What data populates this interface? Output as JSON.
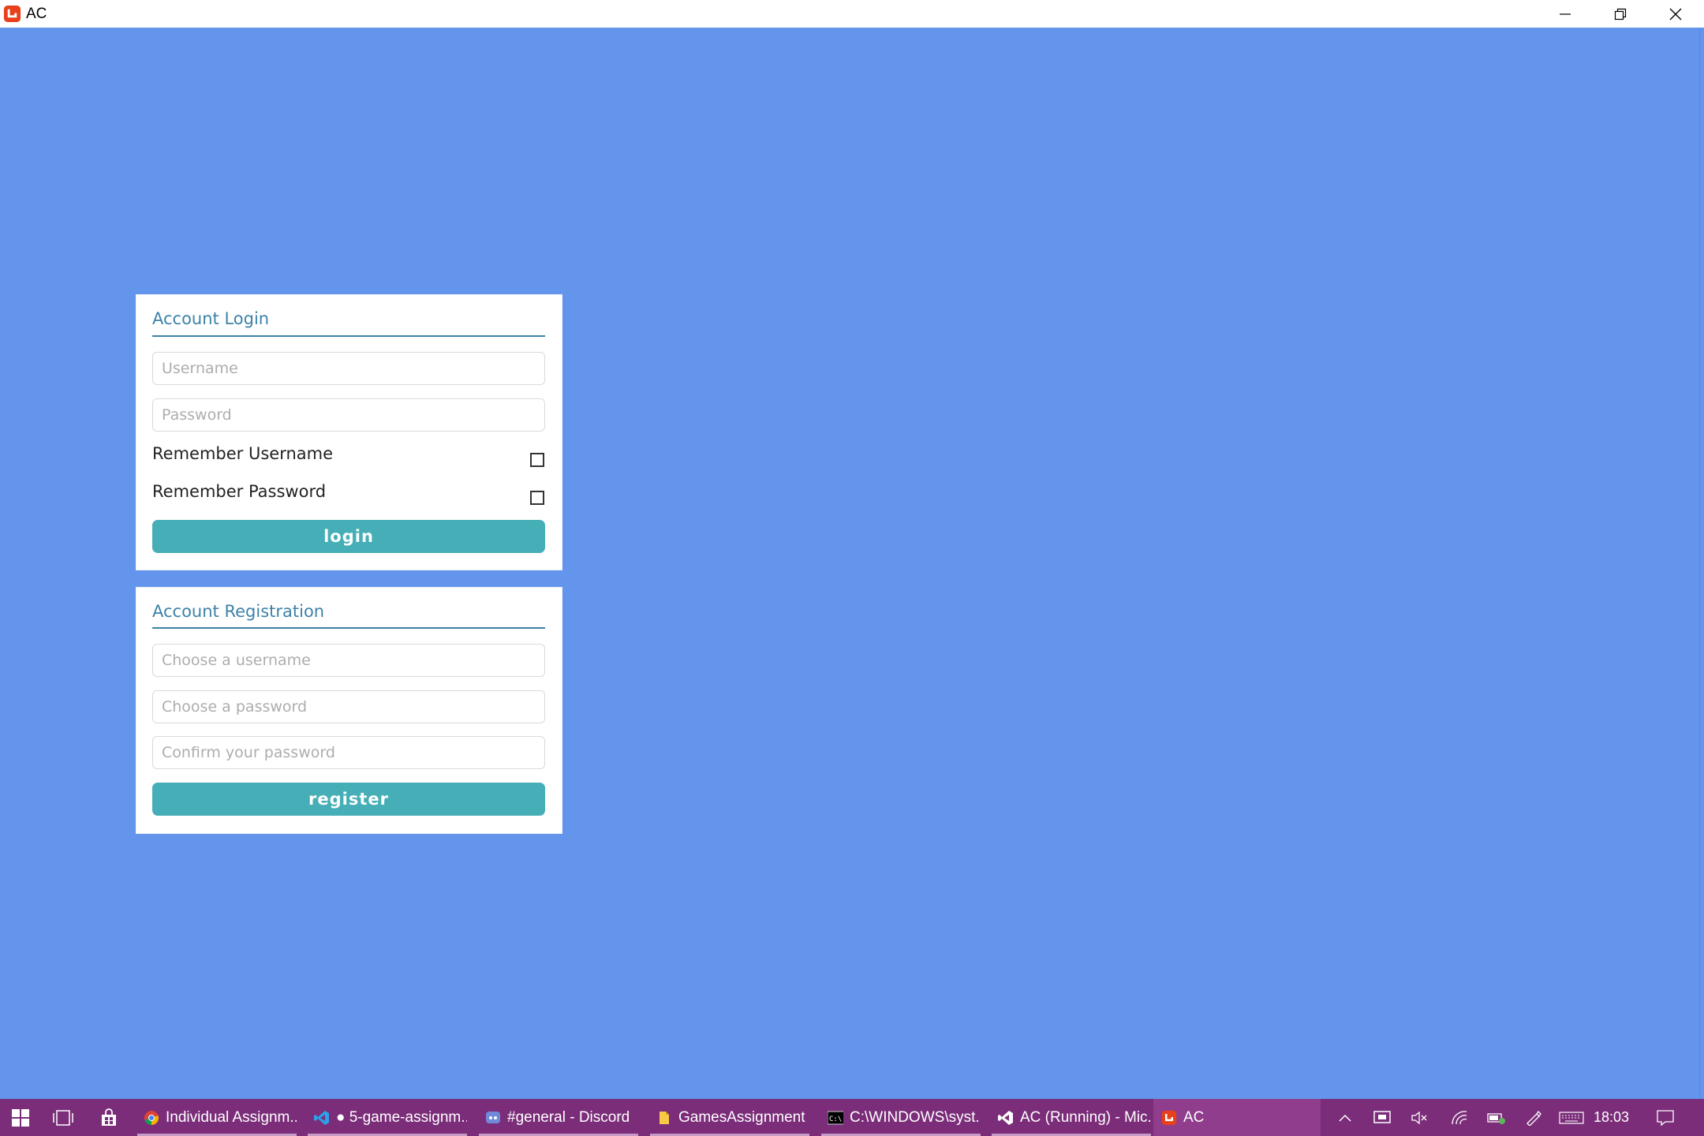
{
  "window": {
    "title": "AC"
  },
  "login": {
    "title": "Account Login",
    "username_placeholder": "Username",
    "password_placeholder": "Password",
    "remember_username": "Remember Username",
    "remember_password": "Remember Password",
    "remember_username_checked": false,
    "remember_password_checked": false,
    "button": "login"
  },
  "register": {
    "title": "Account Registration",
    "username_placeholder": "Choose a username",
    "password_placeholder": "Choose a password",
    "confirm_placeholder": "Confirm your password",
    "button": "register"
  },
  "taskbar": {
    "items": [
      {
        "label": "Individual Assignm...",
        "icon": "chrome-icon"
      },
      {
        "label": "● 5-game-assignm...",
        "icon": "vscode-icon"
      },
      {
        "label": "#general - Discord",
        "icon": "discord-icon"
      },
      {
        "label": "GamesAssignment",
        "icon": "folder-icon"
      },
      {
        "label": "C:\\WINDOWS\\syst...",
        "icon": "cmd-icon"
      },
      {
        "label": "AC (Running) - Mic...",
        "icon": "visual-studio-icon"
      },
      {
        "label": "AC",
        "icon": "monogame-icon",
        "active": true
      }
    ],
    "clock": "18:03"
  },
  "colors": {
    "background": "#6495ED",
    "accent": "#3d82a8",
    "button": "#45aeb6",
    "taskbar": "#7b2d79"
  }
}
